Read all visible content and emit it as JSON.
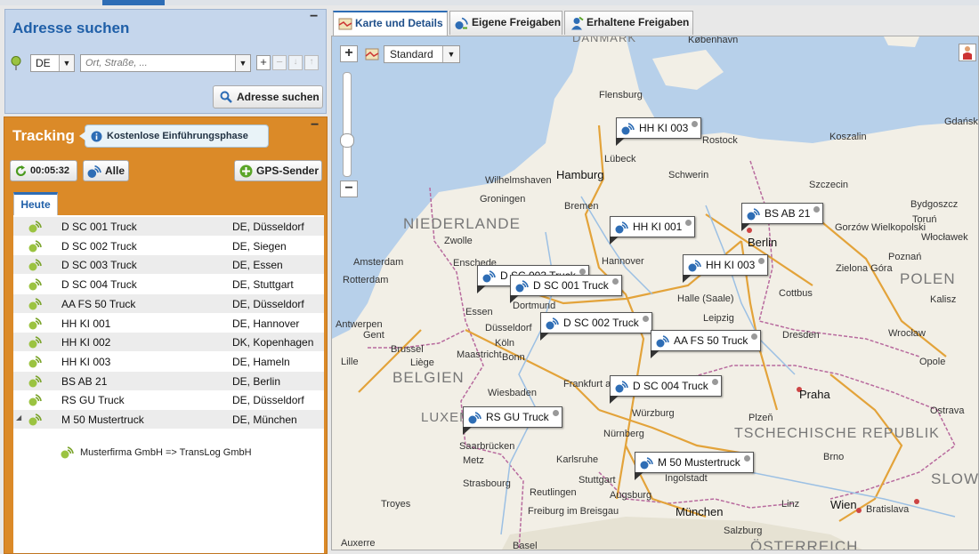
{
  "address": {
    "title": "Adresse suchen",
    "country": "DE",
    "placeholder": "Ort, Straße, ...",
    "search_label": "Adresse suchen"
  },
  "tracking": {
    "title": "Tracking",
    "promo": "Kostenlose Einführungsphase",
    "timer": "00:05:32",
    "all_label": "Alle",
    "gps_label": "GPS-Sender",
    "tab_today": "Heute",
    "vehicles": [
      {
        "name": "D SC 001 Truck",
        "location": "DE, Düsseldorf"
      },
      {
        "name": "D SC 002 Truck",
        "location": "DE, Siegen"
      },
      {
        "name": "D SC 003 Truck",
        "location": "DE, Essen"
      },
      {
        "name": "D SC 004 Truck",
        "location": "DE, Stuttgart"
      },
      {
        "name": "AA FS 50 Truck",
        "location": "DE, Düsseldorf"
      },
      {
        "name": "HH KI 001",
        "location": "DE, Hannover"
      },
      {
        "name": "HH KI 002",
        "location": "DK, Kopenhagen"
      },
      {
        "name": "HH KI 003",
        "location": "DE, Hameln"
      },
      {
        "name": "BS AB 21",
        "location": "DE, Berlin"
      },
      {
        "name": "RS GU Truck",
        "location": "DE, Düsseldorf"
      },
      {
        "name": "M 50 Mustertruck",
        "location": "DE, München"
      }
    ],
    "shared_note": "Musterfirma GmbH => TransLog GmbH"
  },
  "map": {
    "tabs": [
      {
        "label": "Karte und Details"
      },
      {
        "label": "Eigene Freigaben"
      },
      {
        "label": "Erhaltene Freigaben"
      }
    ],
    "map_type": "Standard",
    "countries": [
      "NIEDERLANDE",
      "BELGIEN",
      "POLEN",
      "TSCHECHISCHE REPUBLIK",
      "LUXEM",
      "ÖSTERREICH",
      "SLOWA",
      "DANMARK"
    ],
    "cities": [
      "København",
      "Flensburg",
      "Lübeck",
      "Rostock",
      "Schwerin",
      "Hamburg",
      "Koszalin",
      "Gdańsk",
      "Szczecin",
      "Bremen",
      "Groningen",
      "Wilhelmshaven",
      "Zwolle",
      "Amsterdam",
      "Rotterdam",
      "Enschede",
      "Hannover",
      "Berlin",
      "Bydgoszcz",
      "Toruń",
      "Gorzów Wielkopolski",
      "Włocławek",
      "Poznań",
      "Zielona Góra",
      "Halle (Saale)",
      "Cottbus",
      "Kalisz",
      "Essen",
      "Dortmund",
      "Düsseldorf",
      "Köln",
      "Bonn",
      "Leipzig",
      "Dresden",
      "Wrocław",
      "Antwerpen",
      "Gent",
      "Brussel",
      "Liège",
      "Maastricht",
      "Lille",
      "Opole",
      "Wiesbaden",
      "Frankfurt am Main",
      "Würzburg",
      "Praha",
      "Ostrava",
      "Saarbrücken",
      "Nürnberg",
      "Plzeň",
      "Brno",
      "Metz",
      "Karlsruhe",
      "Strasbourg",
      "Stuttgart",
      "Reutlingen",
      "Augsburg",
      "Ingolstadt",
      "München",
      "Freiburg im Breisgau",
      "Wien",
      "Bratislava",
      "Linz",
      "Salzburg",
      "Basel",
      "Troyes",
      "Auxerre"
    ],
    "markers": [
      {
        "label": "HH KI 003"
      },
      {
        "label": "HH KI 001"
      },
      {
        "label": "BS AB 21"
      },
      {
        "label": "HH KI 003"
      },
      {
        "label": "D SC 003 Truck"
      },
      {
        "label": "D SC 001 Truck"
      },
      {
        "label": "D SC 002 Truck"
      },
      {
        "label": "AA FS 50 Truck"
      },
      {
        "label": "D SC 004 Truck"
      },
      {
        "label": "RS GU Truck"
      },
      {
        "label": "M 50 Mustertruck"
      }
    ]
  },
  "colors": {
    "accent": "#2e6db5",
    "tracking": "#db8a28",
    "panel": "#c5d6ec"
  }
}
